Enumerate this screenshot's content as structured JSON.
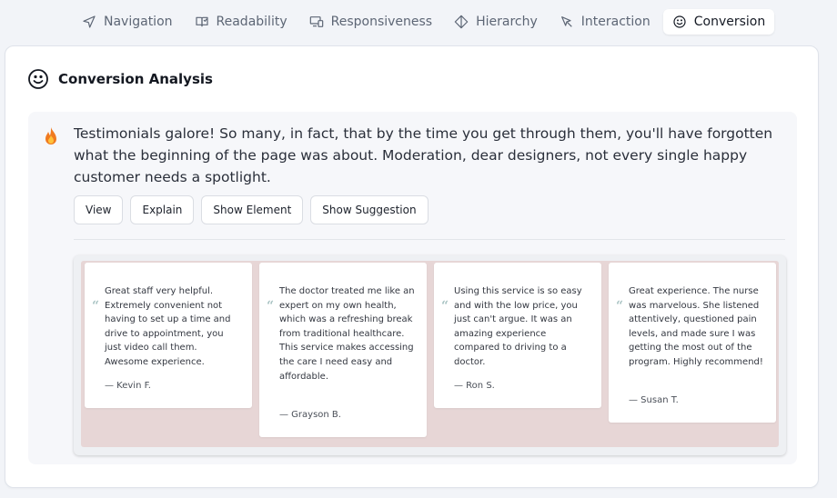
{
  "tabs": [
    {
      "label": "Navigation",
      "icon": "navigation-arrow-icon",
      "active": false
    },
    {
      "label": "Readability",
      "icon": "book-icon",
      "active": false
    },
    {
      "label": "Responsiveness",
      "icon": "devices-icon",
      "active": false
    },
    {
      "label": "Hierarchy",
      "icon": "diamond-layers-icon",
      "active": false
    },
    {
      "label": "Interaction",
      "icon": "cursor-click-icon",
      "active": false
    },
    {
      "label": "Conversion",
      "icon": "smiley-icon",
      "active": true
    }
  ],
  "card": {
    "title": "Conversion Analysis",
    "icon": "smiley-icon"
  },
  "finding": {
    "icon": "fire-icon",
    "text": "Testimonials galore! So many, in fact, that by the time you get through them, you'll have forgotten what the beginning of the page was about. Moderation, dear designers, not every single happy customer needs a spotlight.",
    "buttons": {
      "view": "View",
      "explain": "Explain",
      "show_element": "Show Element",
      "show_suggestion": "Show Suggestion"
    }
  },
  "testimonials": [
    {
      "quote_mark": "“",
      "text": "Great staff very helpful. Extremely convenient not having to set up a time and drive to appointment, you just video call them. Awesome experience.",
      "author": "— Kevin F."
    },
    {
      "quote_mark": "“",
      "text": "The doctor treated me like an expert on my own health, which was a refreshing break from traditional healthcare. This service makes accessing the care I need easy and affordable.",
      "author": "— Grayson B."
    },
    {
      "quote_mark": "“",
      "text": "Using this service is so easy and with the low price, you just can't argue. It was an amazing experience compared to driving to a doctor.",
      "author": "— Ron S."
    },
    {
      "quote_mark": "“",
      "text": "Great experience. The nurse was marvelous. She listened attentively, questioned pain levels, and made sure I was getting the most out of the program. Highly recommend!",
      "author": "— Susan T."
    }
  ],
  "colors": {
    "accent_fire": "#f07a1f",
    "preview_background": "#e7d6d6",
    "quote_mark": "#aac4c4"
  }
}
